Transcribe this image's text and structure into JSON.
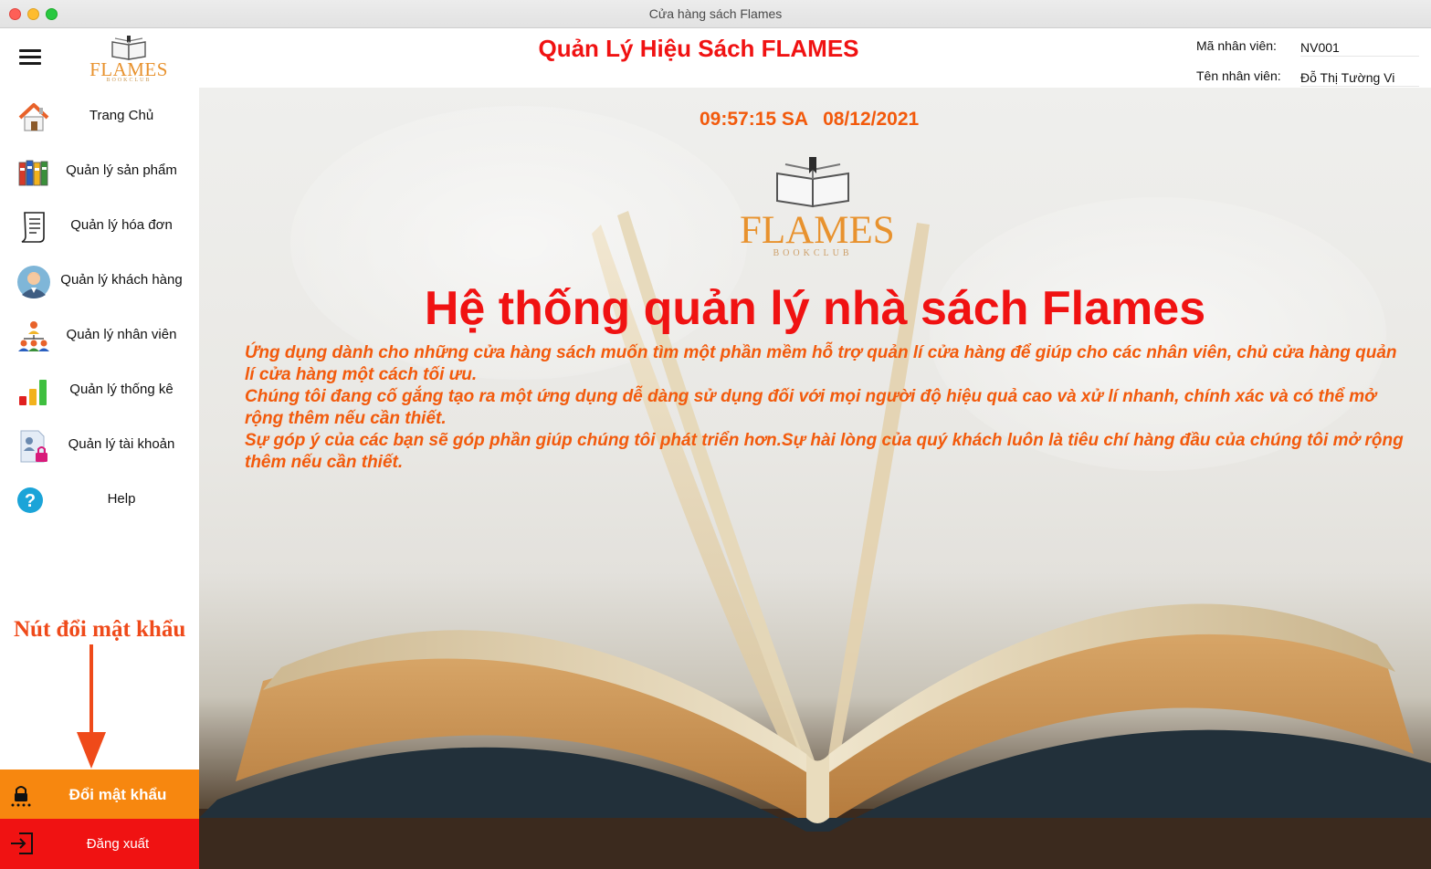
{
  "window": {
    "title": "Cửa hàng sách Flames"
  },
  "header": {
    "logo_text": "FLAMES",
    "logo_sub": "BOOKCLUB",
    "app_title": "Quản Lý Hiệu Sách FLAMES",
    "employee_id_label": "Mã nhân viên:",
    "employee_id_value": "NV001",
    "employee_name_label": "Tên nhân viên:",
    "employee_name_value": "Đỗ Thị Tường Vi"
  },
  "sidebar": {
    "items": [
      {
        "label": "Trang Chủ",
        "icon": "home-icon"
      },
      {
        "label": "Quản lý sản phẩm",
        "icon": "books-icon"
      },
      {
        "label": "Quản lý hóa đơn",
        "icon": "invoice-icon"
      },
      {
        "label": "Quản lý khách hàng",
        "icon": "customer-icon"
      },
      {
        "label": "Quản lý nhân viên",
        "icon": "employees-icon"
      },
      {
        "label": "Quản lý thống kê",
        "icon": "bar-chart-icon"
      },
      {
        "label": "Quản lý tài khoản",
        "icon": "account-lock-icon"
      },
      {
        "label": "Help",
        "icon": "help-icon"
      }
    ],
    "annotation": "Nút đổi mật khẩu",
    "change_password_label": "Đổi mật khẩu",
    "logout_label": "Đăng xuất"
  },
  "main": {
    "time": "09:57:15 SA",
    "date": "08/12/2021",
    "logo_text": "FLAMES",
    "logo_sub": "BOOKCLUB",
    "heading": "Hệ thống quản lý nhà sách Flames",
    "description": [
      "Ứng dụng dành cho những cửa hàng sách muốn tìm một phần mềm hỗ trợ quản lí cửa hàng để giúp cho các nhân viên, chủ cửa hàng quản lí cửa hàng một cách tối ưu.",
      "Chúng tôi đang cố gắng tạo ra một ứng dụng dễ dàng sử dụng đối với mọi người độ hiệu quả cao và xử lí nhanh, chính xác và có thể mở rộng thêm nếu cần thiết.",
      "Sự góp ý của các bạn sẽ góp phần giúp chúng tôi phát triển hơn.Sự hài lòng của quý khách luôn là tiêu chí hàng đầu của chúng tôi mở rộng thêm nếu cần thiết."
    ]
  },
  "colors": {
    "accent_red": "#f01212",
    "accent_orange": "#f25a0c",
    "button_orange": "#f7870f",
    "logo_gold": "#e8922e"
  }
}
